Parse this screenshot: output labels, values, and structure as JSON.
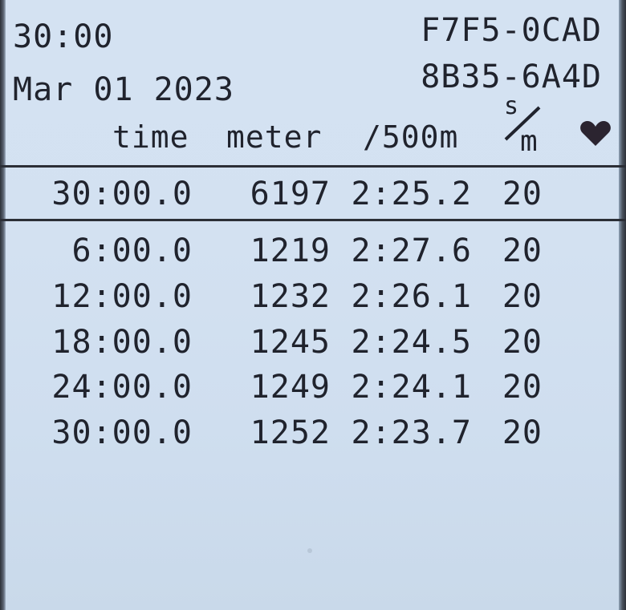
{
  "header": {
    "elapsed_time": "30:00",
    "date": "Mar 01 2023",
    "serial_line_1": "F7F5-0CAD",
    "serial_line_2": "8B35-6A4D"
  },
  "columns": {
    "time": "time",
    "meter": "meter",
    "pace": "/500m",
    "stroke_rate_top": "s",
    "stroke_rate_bottom": "m",
    "heart_rate_icon": "heart-icon"
  },
  "summary": {
    "time": "30:00.0",
    "meter": "6197",
    "pace": "2:25.2",
    "spm": "20"
  },
  "splits": [
    {
      "time": "6:00.0",
      "meter": "1219",
      "pace": "2:27.6",
      "spm": "20"
    },
    {
      "time": "12:00.0",
      "meter": "1232",
      "pace": "2:26.1",
      "spm": "20"
    },
    {
      "time": "18:00.0",
      "meter": "1245",
      "pace": "2:24.5",
      "spm": "20"
    },
    {
      "time": "24:00.0",
      "meter": "1249",
      "pace": "2:24.1",
      "spm": "20"
    },
    {
      "time": "30:00.0",
      "meter": "1252",
      "pace": "2:23.7",
      "spm": "20"
    }
  ],
  "colors": {
    "screen_background": "#d3e1f1",
    "text": "#20232d",
    "rule": "#2b2e36"
  }
}
